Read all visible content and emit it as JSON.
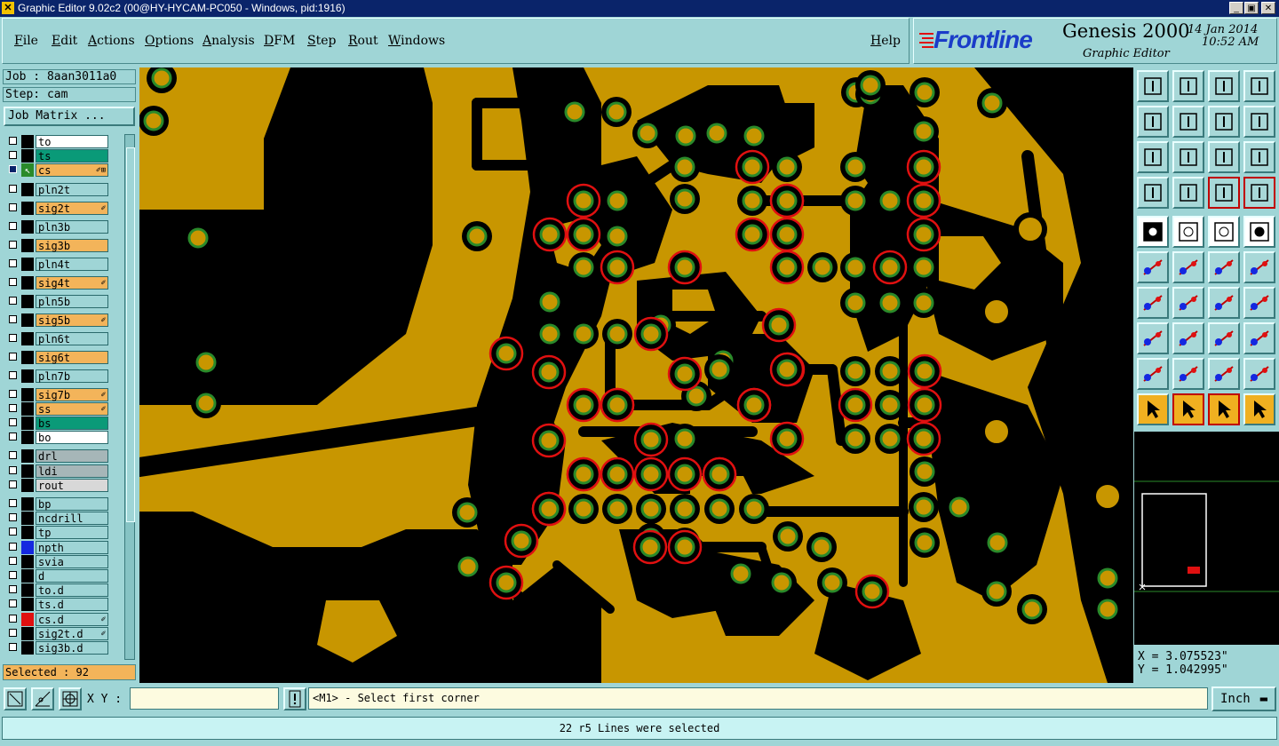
{
  "window": {
    "title": "Graphic Editor 9.02c2 (00@HY-HYCAM-PC050 - Windows, pid:1916)"
  },
  "menu": {
    "file": "File",
    "edit": "Edit",
    "actions": "Actions",
    "options": "Options",
    "analysis": "Analysis",
    "dfm": "DFM",
    "step": "Step",
    "rout": "Rout",
    "windows": "Windows",
    "help": "Help"
  },
  "brand": {
    "logo": "Frontline",
    "product": "Genesis 2000",
    "subtitle": "Graphic Editor",
    "date": "14 Jan 2014",
    "time": "10:52 AM"
  },
  "job": {
    "job_line": "Job : 8aan3011a0",
    "step_line": "Step: cam",
    "matrix_button": "Job Matrix ..."
  },
  "layers": [
    {
      "name": "to",
      "bg": "#ffffff"
    },
    {
      "name": "ts",
      "bg": "#0a9a78"
    },
    {
      "name": "cs",
      "bg": "#f3b45a",
      "active": true,
      "mark": "✐⊞"
    },
    {
      "name": "pln2t",
      "bg": "#9fd5d6"
    },
    {
      "name": "sig2t",
      "bg": "#f3b45a",
      "mark": "✐"
    },
    {
      "name": "pln3b",
      "bg": "#9fd5d6"
    },
    {
      "name": "sig3b",
      "bg": "#f3b45a"
    },
    {
      "name": "pln4t",
      "bg": "#9fd5d6"
    },
    {
      "name": "sig4t",
      "bg": "#f3b45a",
      "mark": "✐"
    },
    {
      "name": "pln5b",
      "bg": "#9fd5d6"
    },
    {
      "name": "sig5b",
      "bg": "#f3b45a",
      "mark": "✐"
    },
    {
      "name": "pln6t",
      "bg": "#9fd5d6"
    },
    {
      "name": "sig6t",
      "bg": "#f3b45a"
    },
    {
      "name": "pln7b",
      "bg": "#9fd5d6"
    },
    {
      "name": "sig7b",
      "bg": "#f3b45a",
      "mark": "✐"
    },
    {
      "name": "ss",
      "bg": "#f3b45a",
      "mark": "✐"
    },
    {
      "name": "bs",
      "bg": "#0a9a78"
    },
    {
      "name": "bo",
      "bg": "#ffffff"
    },
    {
      "name": "drl",
      "bg": "#a6b6b8"
    },
    {
      "name": "ldi",
      "bg": "#a6b6b8"
    },
    {
      "name": "rout",
      "bg": "#d8d8d8"
    },
    {
      "name": "bp",
      "bg": "#9fd5d6"
    },
    {
      "name": "ncdrill",
      "bg": "#9fd5d6"
    },
    {
      "name": "tp",
      "bg": "#9fd5d6"
    },
    {
      "name": "npth",
      "bg": "#9fd5d6",
      "color": "#1428e0"
    },
    {
      "name": "svia",
      "bg": "#9fd5d6"
    },
    {
      "name": "d",
      "bg": "#9fd5d6"
    },
    {
      "name": "to.d",
      "bg": "#9fd5d6"
    },
    {
      "name": "ts.d",
      "bg": "#9fd5d6"
    },
    {
      "name": "cs.d",
      "bg": "#9fd5d6",
      "color": "#e01010",
      "mark": "✐"
    },
    {
      "name": "sig2t.d",
      "bg": "#9fd5d6",
      "mark": "✐"
    },
    {
      "name": "sig3b.d",
      "bg": "#9fd5d6"
    }
  ],
  "selection": {
    "label": "Selected : 92"
  },
  "coords": {
    "x": "X = 3.075523\"",
    "y": "Y = 1.042995\""
  },
  "bottom": {
    "xy_label": "X Y :",
    "xy_value": "",
    "prompt": "<M1> - Select first corner",
    "unit": "Inch"
  },
  "status": "22 r5 Lines were selected",
  "colors": {
    "copper": "#c89600",
    "pad_fill": "#8a9a2a",
    "pad_ring": "#2a8a2a",
    "selected": "#e01010",
    "panel": "#9fd5d6"
  }
}
